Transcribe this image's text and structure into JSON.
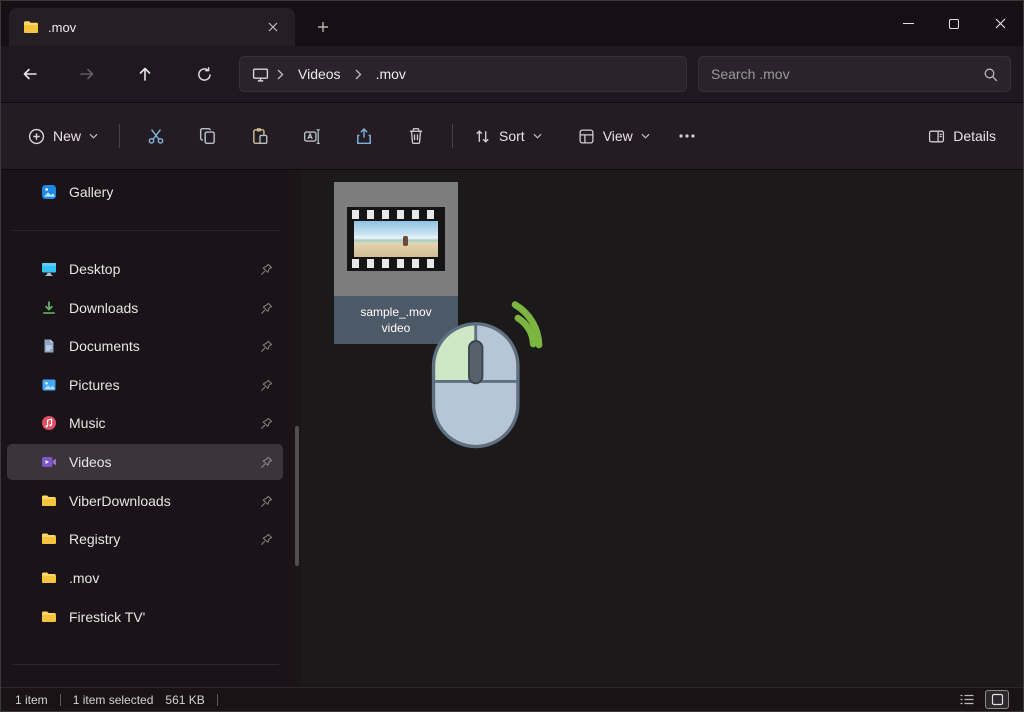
{
  "window": {
    "tab_title": ".mov"
  },
  "navbar": {
    "breadcrumb": [
      "Videos",
      ".mov"
    ],
    "search_placeholder": "Search .mov"
  },
  "toolbar": {
    "new_label": "New",
    "sort_label": "Sort",
    "view_label": "View",
    "details_label": "Details"
  },
  "sidebar": {
    "items": [
      {
        "label": "Gallery"
      },
      {
        "label": "Desktop"
      },
      {
        "label": "Downloads"
      },
      {
        "label": "Documents"
      },
      {
        "label": "Pictures"
      },
      {
        "label": "Music"
      },
      {
        "label": "Videos"
      },
      {
        "label": "ViberDownloads"
      },
      {
        "label": "Registry"
      },
      {
        "label": ".mov"
      },
      {
        "label": "Firestick TV'"
      }
    ]
  },
  "content": {
    "file": {
      "name": "sample_.mov",
      "kind": "video"
    }
  },
  "statusbar": {
    "item_count": "1 item",
    "selection": "1 item selected",
    "size": "561 KB"
  },
  "colors": {
    "selection_label_bg": "#4c5a67",
    "mouse_green": "#7cb53f",
    "folder_yellow": "#fdd663"
  }
}
